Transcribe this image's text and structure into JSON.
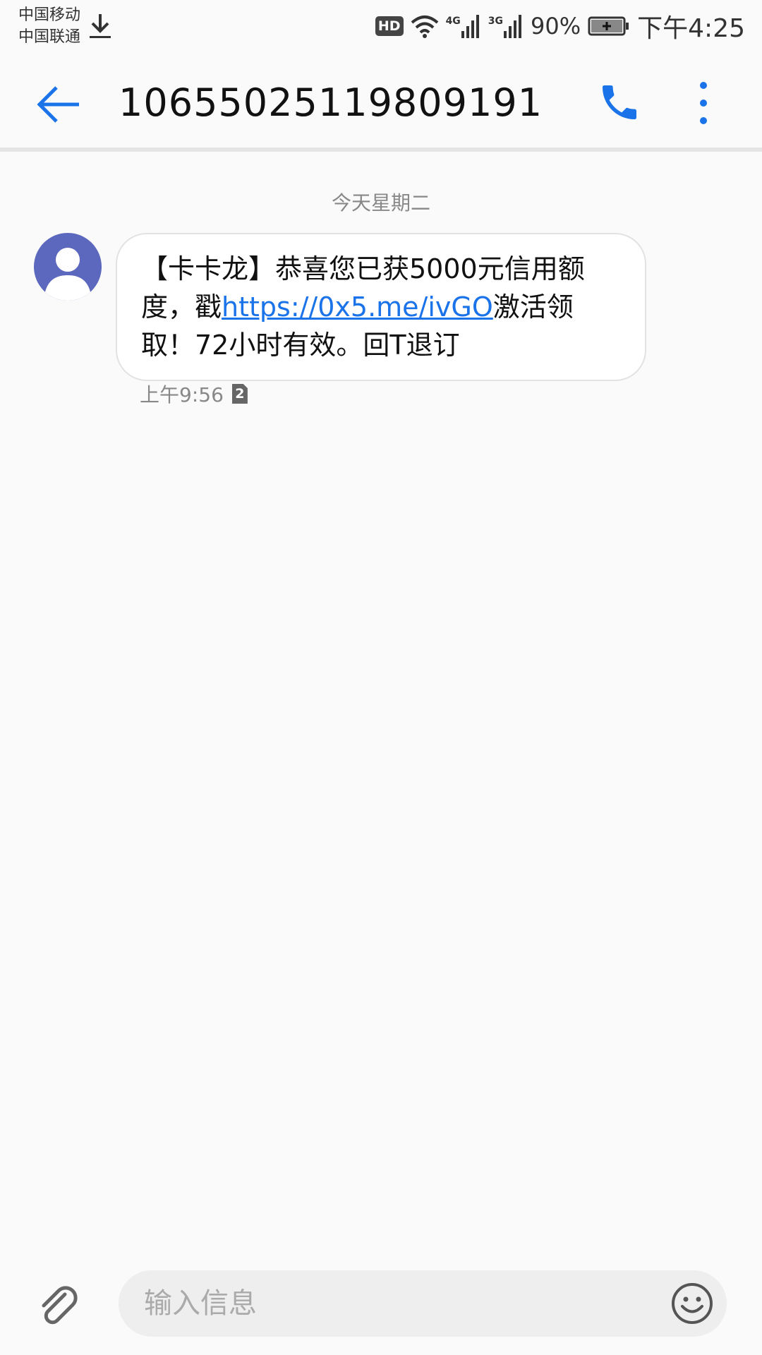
{
  "status_bar": {
    "carrier_1": "中国移动",
    "carrier_2": "中国联通",
    "hd": "HD",
    "network_1": "4G",
    "network_2": "3G",
    "battery": "90%",
    "time": "下午4:25"
  },
  "app_bar": {
    "title": "10655025119809191"
  },
  "conversation": {
    "date_label": "今天星期二",
    "message": {
      "text_before": "【卡卡龙】恭喜您已获5000元信用额度，戳",
      "link": "https://0x5.me/ivGO",
      "text_after": "激活领取！72小时有效。回T退订",
      "time": "上午9:56",
      "sim": "2"
    }
  },
  "input_bar": {
    "placeholder": "输入信息"
  },
  "colors": {
    "accent": "#1a73e8",
    "avatar": "#5c67be"
  }
}
